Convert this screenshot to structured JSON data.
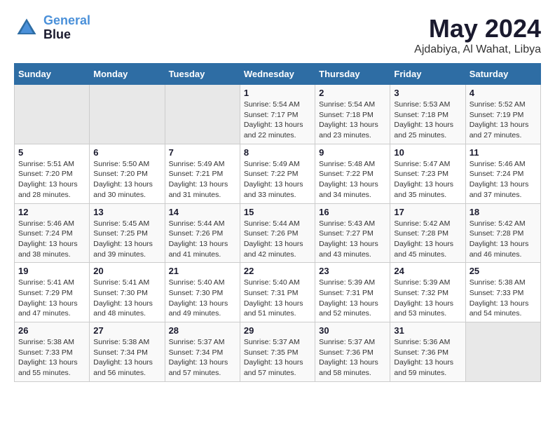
{
  "logo": {
    "line1": "General",
    "line2": "Blue"
  },
  "title": "May 2024",
  "subtitle": "Ajdabiya, Al Wahat, Libya",
  "days_of_week": [
    "Sunday",
    "Monday",
    "Tuesday",
    "Wednesday",
    "Thursday",
    "Friday",
    "Saturday"
  ],
  "weeks": [
    [
      {
        "day": "",
        "empty": true
      },
      {
        "day": "",
        "empty": true
      },
      {
        "day": "",
        "empty": true
      },
      {
        "day": "1",
        "sunrise": "5:54 AM",
        "sunset": "7:17 PM",
        "daylight": "13 hours and 22 minutes."
      },
      {
        "day": "2",
        "sunrise": "5:54 AM",
        "sunset": "7:18 PM",
        "daylight": "13 hours and 23 minutes."
      },
      {
        "day": "3",
        "sunrise": "5:53 AM",
        "sunset": "7:18 PM",
        "daylight": "13 hours and 25 minutes."
      },
      {
        "day": "4",
        "sunrise": "5:52 AM",
        "sunset": "7:19 PM",
        "daylight": "13 hours and 27 minutes."
      }
    ],
    [
      {
        "day": "5",
        "sunrise": "5:51 AM",
        "sunset": "7:20 PM",
        "daylight": "13 hours and 28 minutes."
      },
      {
        "day": "6",
        "sunrise": "5:50 AM",
        "sunset": "7:20 PM",
        "daylight": "13 hours and 30 minutes."
      },
      {
        "day": "7",
        "sunrise": "5:49 AM",
        "sunset": "7:21 PM",
        "daylight": "13 hours and 31 minutes."
      },
      {
        "day": "8",
        "sunrise": "5:49 AM",
        "sunset": "7:22 PM",
        "daylight": "13 hours and 33 minutes."
      },
      {
        "day": "9",
        "sunrise": "5:48 AM",
        "sunset": "7:22 PM",
        "daylight": "13 hours and 34 minutes."
      },
      {
        "day": "10",
        "sunrise": "5:47 AM",
        "sunset": "7:23 PM",
        "daylight": "13 hours and 35 minutes."
      },
      {
        "day": "11",
        "sunrise": "5:46 AM",
        "sunset": "7:24 PM",
        "daylight": "13 hours and 37 minutes."
      }
    ],
    [
      {
        "day": "12",
        "sunrise": "5:46 AM",
        "sunset": "7:24 PM",
        "daylight": "13 hours and 38 minutes."
      },
      {
        "day": "13",
        "sunrise": "5:45 AM",
        "sunset": "7:25 PM",
        "daylight": "13 hours and 39 minutes."
      },
      {
        "day": "14",
        "sunrise": "5:44 AM",
        "sunset": "7:26 PM",
        "daylight": "13 hours and 41 minutes."
      },
      {
        "day": "15",
        "sunrise": "5:44 AM",
        "sunset": "7:26 PM",
        "daylight": "13 hours and 42 minutes."
      },
      {
        "day": "16",
        "sunrise": "5:43 AM",
        "sunset": "7:27 PM",
        "daylight": "13 hours and 43 minutes."
      },
      {
        "day": "17",
        "sunrise": "5:42 AM",
        "sunset": "7:28 PM",
        "daylight": "13 hours and 45 minutes."
      },
      {
        "day": "18",
        "sunrise": "5:42 AM",
        "sunset": "7:28 PM",
        "daylight": "13 hours and 46 minutes."
      }
    ],
    [
      {
        "day": "19",
        "sunrise": "5:41 AM",
        "sunset": "7:29 PM",
        "daylight": "13 hours and 47 minutes."
      },
      {
        "day": "20",
        "sunrise": "5:41 AM",
        "sunset": "7:30 PM",
        "daylight": "13 hours and 48 minutes."
      },
      {
        "day": "21",
        "sunrise": "5:40 AM",
        "sunset": "7:30 PM",
        "daylight": "13 hours and 49 minutes."
      },
      {
        "day": "22",
        "sunrise": "5:40 AM",
        "sunset": "7:31 PM",
        "daylight": "13 hours and 51 minutes."
      },
      {
        "day": "23",
        "sunrise": "5:39 AM",
        "sunset": "7:31 PM",
        "daylight": "13 hours and 52 minutes."
      },
      {
        "day": "24",
        "sunrise": "5:39 AM",
        "sunset": "7:32 PM",
        "daylight": "13 hours and 53 minutes."
      },
      {
        "day": "25",
        "sunrise": "5:38 AM",
        "sunset": "7:33 PM",
        "daylight": "13 hours and 54 minutes."
      }
    ],
    [
      {
        "day": "26",
        "sunrise": "5:38 AM",
        "sunset": "7:33 PM",
        "daylight": "13 hours and 55 minutes."
      },
      {
        "day": "27",
        "sunrise": "5:38 AM",
        "sunset": "7:34 PM",
        "daylight": "13 hours and 56 minutes."
      },
      {
        "day": "28",
        "sunrise": "5:37 AM",
        "sunset": "7:34 PM",
        "daylight": "13 hours and 57 minutes."
      },
      {
        "day": "29",
        "sunrise": "5:37 AM",
        "sunset": "7:35 PM",
        "daylight": "13 hours and 57 minutes."
      },
      {
        "day": "30",
        "sunrise": "5:37 AM",
        "sunset": "7:36 PM",
        "daylight": "13 hours and 58 minutes."
      },
      {
        "day": "31",
        "sunrise": "5:36 AM",
        "sunset": "7:36 PM",
        "daylight": "13 hours and 59 minutes."
      },
      {
        "day": "",
        "empty": true
      }
    ]
  ],
  "labels": {
    "sunrise": "Sunrise:",
    "sunset": "Sunset:",
    "daylight": "Daylight:"
  }
}
